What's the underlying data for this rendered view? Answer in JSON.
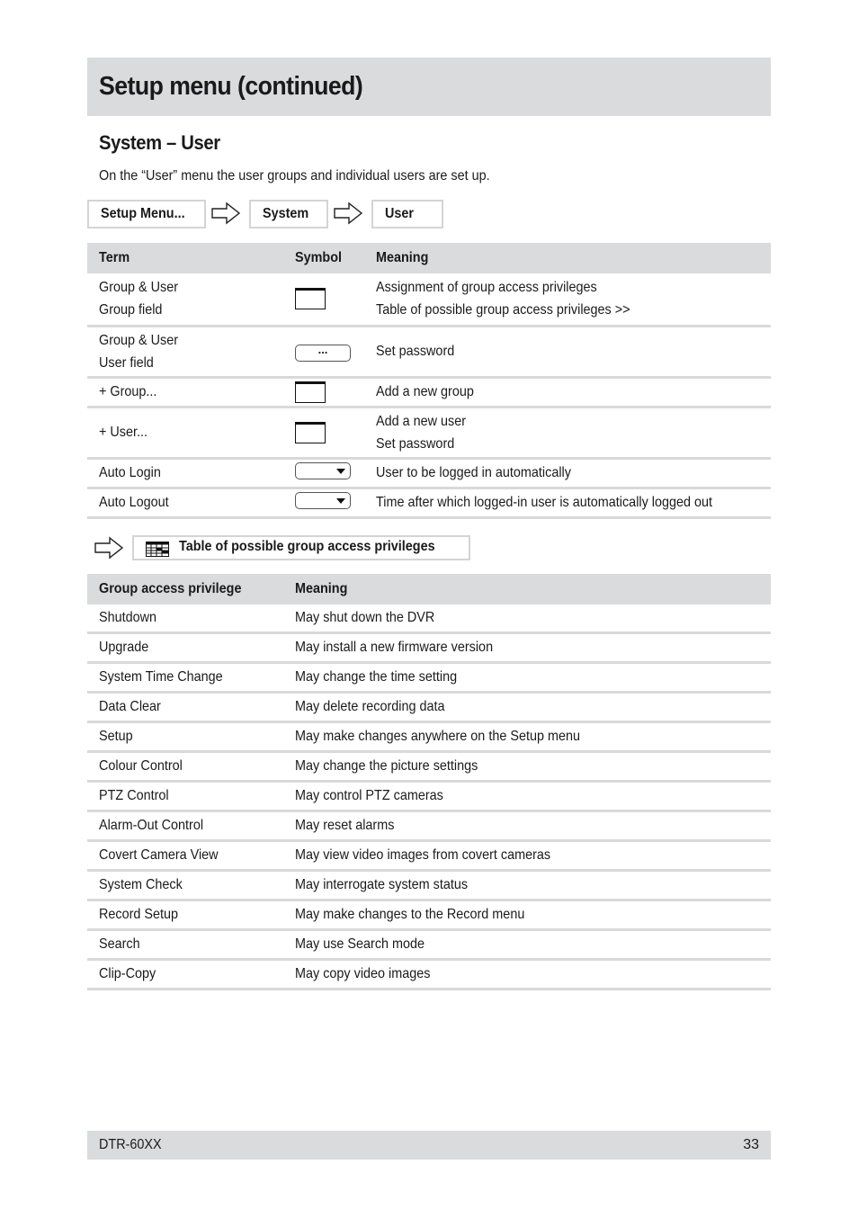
{
  "header": {
    "title": "Setup menu (continued)"
  },
  "section": {
    "title": "System – User",
    "intro": "On the “User” menu the user groups and individual users are set up."
  },
  "breadcrumb": {
    "items": [
      "Setup Menu...",
      "System",
      "User"
    ],
    "separator_icon": "arrow-right-outline-icon"
  },
  "terms_table": {
    "columns": [
      "Term",
      "Symbol",
      "Meaning"
    ],
    "rows": [
      {
        "term": [
          "Group & User",
          "Group field"
        ],
        "symbol": "window-field-icon",
        "meaning": [
          "Assignment of group access privileges",
          "Table of possible group access privileges >>"
        ]
      },
      {
        "term": [
          "Group & User",
          "User field"
        ],
        "symbol": "ellipsis-button-icon",
        "symbol_text": "...",
        "meaning": [
          "Set password"
        ]
      },
      {
        "term": [
          "+ Group..."
        ],
        "symbol": "window-field-icon",
        "meaning": [
          "Add a new group"
        ]
      },
      {
        "term": [
          "+ User..."
        ],
        "symbol": "window-field-icon",
        "meaning": [
          "Add a new user",
          "Set password"
        ]
      },
      {
        "term": [
          "Auto Login"
        ],
        "symbol": "dropdown-icon",
        "meaning": [
          "User to be logged in automatically"
        ]
      },
      {
        "term": [
          "Auto Logout"
        ],
        "symbol": "dropdown-icon",
        "meaning": [
          "Time after which logged-in user is automatically logged out"
        ]
      }
    ]
  },
  "privileges_link": {
    "icon": "table-grid-icon",
    "label": "Table of possible group access privileges"
  },
  "privileges_table": {
    "columns": [
      "Group access privilege",
      "Meaning"
    ],
    "rows": [
      {
        "privilege": "Shutdown",
        "meaning": "May shut down the DVR"
      },
      {
        "privilege": "Upgrade",
        "meaning": "May install a new firmware version"
      },
      {
        "privilege": "System Time Change",
        "meaning": "May change the time setting"
      },
      {
        "privilege": "Data Clear",
        "meaning": "May delete recording data"
      },
      {
        "privilege": "Setup",
        "meaning": "May make changes anywhere on the Setup menu"
      },
      {
        "privilege": "Colour Control",
        "meaning": "May change the picture settings"
      },
      {
        "privilege": "PTZ Control",
        "meaning": "May control PTZ cameras"
      },
      {
        "privilege": "Alarm-Out Control",
        "meaning": "May reset alarms"
      },
      {
        "privilege": "Covert Camera View",
        "meaning": "May view video images from covert cameras"
      },
      {
        "privilege": "System Check",
        "meaning": "May interrogate system status"
      },
      {
        "privilege": "Record Setup",
        "meaning": "May make changes to the Record menu"
      },
      {
        "privilege": "Search",
        "meaning": "May use Search mode"
      },
      {
        "privilege": "Clip-Copy",
        "meaning": "May copy video images"
      }
    ]
  },
  "footer": {
    "model": "DTR-60XX",
    "page": "33"
  },
  "colors": {
    "header_bg": "#dadbdc",
    "row_divider": "#d9d9d9",
    "text": "#1a1a1a"
  }
}
